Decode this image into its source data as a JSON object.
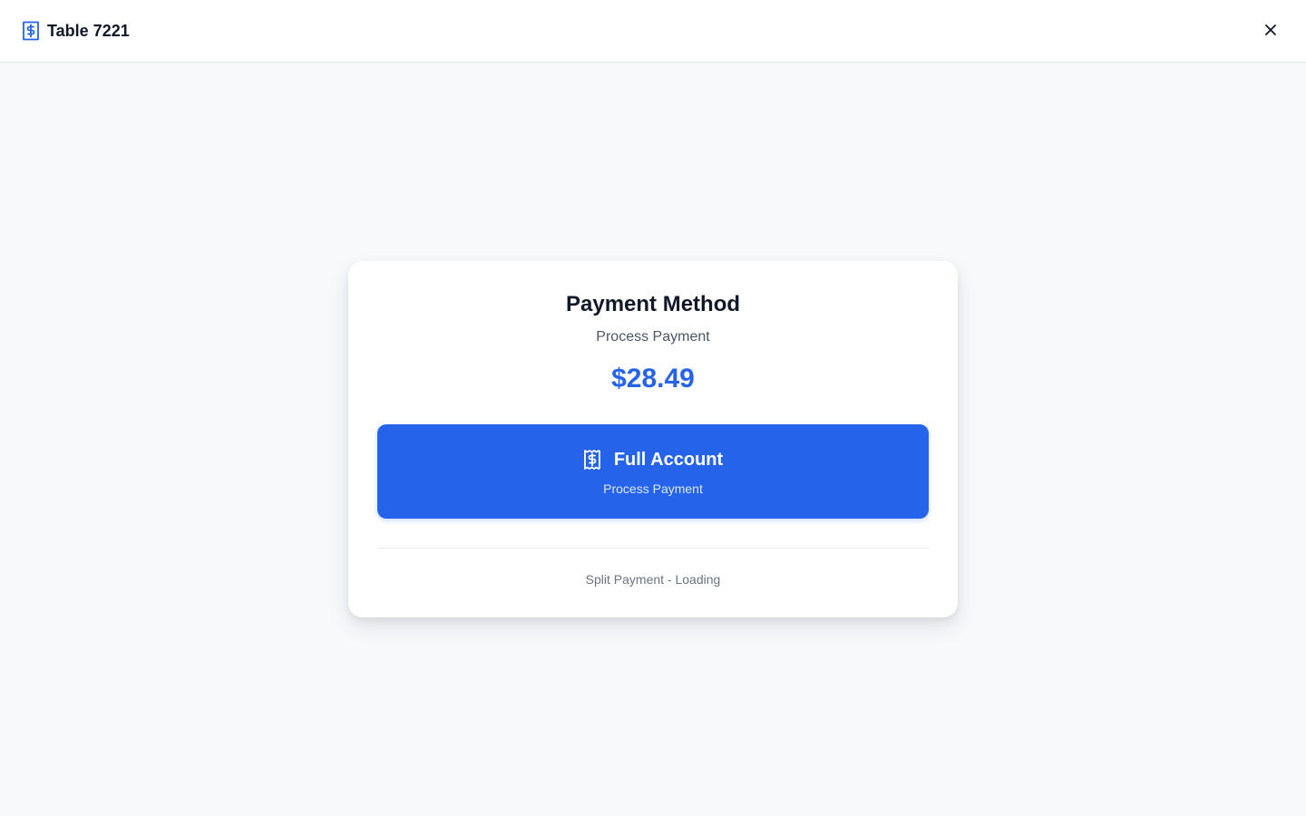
{
  "header": {
    "title": "Table 7221",
    "icon": "receipt-dollar-icon",
    "close_icon": "close-icon"
  },
  "card": {
    "title": "Payment Method",
    "subtitle": "Process Payment",
    "amount": "$28.49",
    "primary_option": {
      "icon": "receipt-dollar-icon",
      "label": "Full Account",
      "sublabel": "Process Payment"
    },
    "secondary_option": {
      "label": "Split Payment - Loading"
    }
  },
  "colors": {
    "accent": "#2563eb",
    "background": "#f8f9fb",
    "card": "#ffffff",
    "text_primary": "#111827",
    "text_secondary": "#4b5563",
    "text_muted": "#6b7280"
  }
}
